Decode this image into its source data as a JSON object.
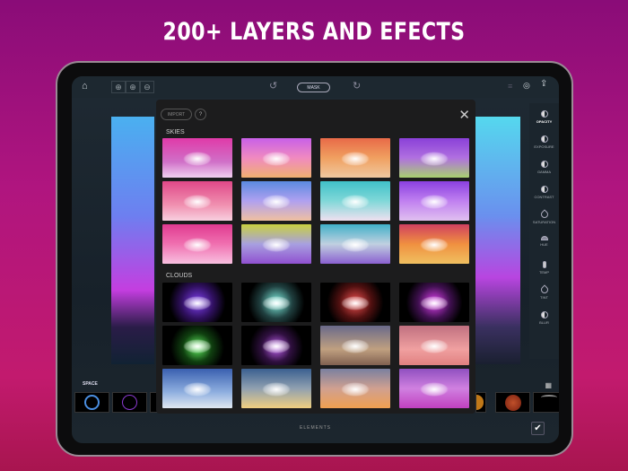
{
  "headline": "200+ LAYERS AND EFECTS",
  "toolbar": {
    "mask_label": "MASK"
  },
  "sidebar": {
    "items": [
      {
        "label": "OPACITY",
        "active": true
      },
      {
        "label": "EXPOSURE"
      },
      {
        "label": "GAMMA"
      },
      {
        "label": "CONTRAST"
      },
      {
        "label": "SATURATION"
      },
      {
        "label": "HUE"
      },
      {
        "label": "TEMP"
      },
      {
        "label": "TINT"
      },
      {
        "label": "BLUR"
      }
    ]
  },
  "modal": {
    "import_label": "IMPORT",
    "help_label": "?",
    "close_label": "✕",
    "sections": [
      {
        "title": "SKIES",
        "count": 12
      },
      {
        "title": "CLOUDS",
        "count": 12
      }
    ]
  },
  "strip": {
    "category": "SPACE"
  },
  "bottom": {
    "title": "ELEMENTS",
    "confirm_label": "✔"
  }
}
